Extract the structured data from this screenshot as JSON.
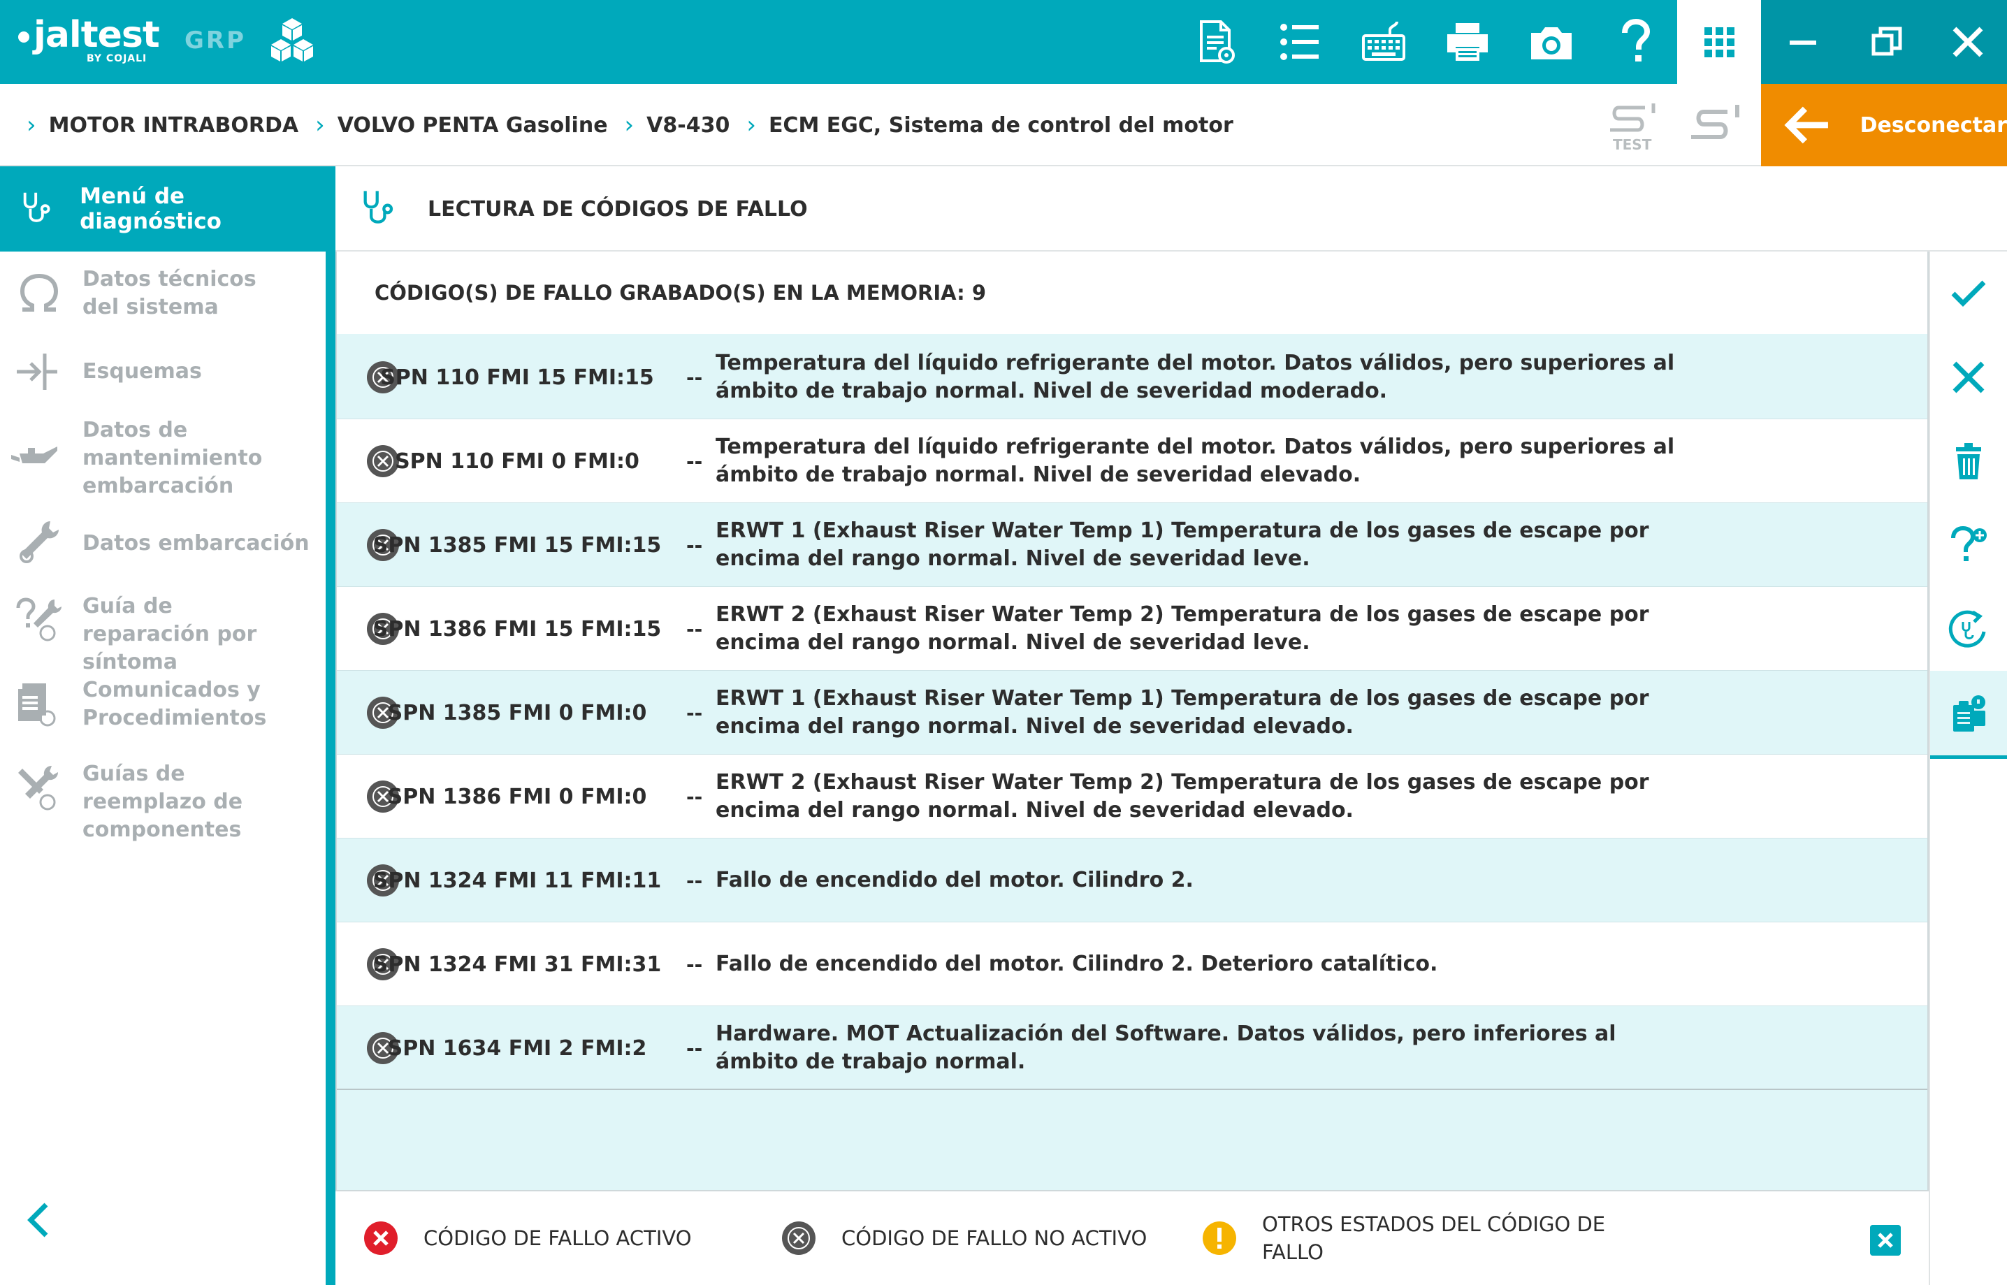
{
  "app": {
    "logo_text": "jaltest",
    "logo_sub": "BY COJALI",
    "product_badge": "GRP"
  },
  "toolbar": {
    "icons": [
      "report-icon",
      "list-icon",
      "keyboard-icon",
      "printer-icon",
      "camera-icon",
      "help-icon",
      "grid-icon"
    ],
    "window_controls": [
      "minimize-icon",
      "restore-icon",
      "close-icon"
    ]
  },
  "breadcrumb": {
    "items": [
      "MOTOR INTRABORDA",
      "VOLVO PENTA Gasoline",
      "V8-430",
      "ECM EGC, Sistema de control del motor"
    ],
    "test_label": "TEST",
    "disconnect_label": "Desconectar"
  },
  "sidebar": {
    "active_label": "Menú de diagnóstico",
    "items": [
      {
        "label": "Datos técnicos del sistema",
        "icon": "omega-icon"
      },
      {
        "label": "Esquemas",
        "icon": "schematic-icon"
      },
      {
        "label": "Datos de mantenimiento embarcación",
        "icon": "oil-can-icon"
      },
      {
        "label": "Datos embarcación",
        "icon": "wrench-icon"
      },
      {
        "label": "Guía de reparación por síntoma",
        "icon": "repair-guide-icon"
      },
      {
        "label": "Comunicados y Procedimientos",
        "icon": "documents-icon"
      },
      {
        "label": "Guías de reemplazo de componentes",
        "icon": "tools-icon"
      }
    ]
  },
  "main": {
    "section_title": "LECTURA DE CÓDIGOS DE FALLO",
    "memory_title": "CÓDIGO(S) DE FALLO GRABADO(S) EN LA MEMORIA: 9",
    "separator": "--",
    "faults": [
      {
        "code": "SPN 110 FMI 15 FMI:15",
        "status": "not-active",
        "description": "Temperatura del líquido refrigerante del motor. Datos válidos, pero superiores al ámbito de trabajo normal. Nivel de severidad moderado."
      },
      {
        "code": "SPN 110 FMI 0 FMI:0",
        "status": "not-active",
        "description": "Temperatura del líquido refrigerante del motor. Datos válidos, pero superiores al ámbito de trabajo normal. Nivel de severidad elevado."
      },
      {
        "code": "SPN 1385 FMI 15 FMI:15",
        "status": "not-active",
        "description": "ERWT 1 (Exhaust Riser Water Temp 1) Temperatura de los gases de escape por encima del rango normal. Nivel de severidad leve."
      },
      {
        "code": "SPN 1386 FMI 15 FMI:15",
        "status": "not-active",
        "description": "ERWT 2 (Exhaust Riser Water Temp 2) Temperatura de los gases de escape por encima del rango normal. Nivel de severidad leve."
      },
      {
        "code": "SPN 1385 FMI 0 FMI:0",
        "status": "not-active",
        "description": "ERWT 1 (Exhaust Riser Water Temp 1) Temperatura de los gases de escape por encima del rango normal. Nivel de severidad elevado."
      },
      {
        "code": "SPN 1386 FMI 0 FMI:0",
        "status": "not-active",
        "description": "ERWT 2 (Exhaust Riser Water Temp 2) Temperatura de los gases de escape por encima del rango normal. Nivel de severidad elevado."
      },
      {
        "code": "SPN 1324 FMI 11 FMI:11",
        "status": "not-active",
        "description": "Fallo de encendido del motor. Cilindro 2."
      },
      {
        "code": "SPN 1324 FMI 31 FMI:31",
        "status": "not-active",
        "description": "Fallo de encendido del motor. Cilindro 2. Deterioro catalítico."
      },
      {
        "code": "SPN 1634 FMI 2 FMI:2",
        "status": "not-active",
        "description": "Hardware. MOT Actualización del Software. Datos válidos, pero inferiores al ámbito de trabajo normal."
      }
    ]
  },
  "legend": {
    "active": "CÓDIGO DE FALLO ACTIVO",
    "not_active": "CÓDIGO DE FALLO NO ACTIVO",
    "other": "OTROS ESTADOS DEL CÓDIGO DE FALLO"
  },
  "right_toolbar": {
    "buttons": [
      "check-icon",
      "close-icon",
      "trash-icon",
      "help-plus-icon",
      "refresh-diagnostic-icon",
      "fault-report-icon"
    ],
    "active_index": 5
  },
  "colors": {
    "brand": "#00a9bb",
    "disconnect": "#f08c00",
    "row_alt": "#e0f6f8",
    "active_fault": "#e01e2b",
    "inactive_fault": "#555555",
    "warning": "#f6b400"
  }
}
